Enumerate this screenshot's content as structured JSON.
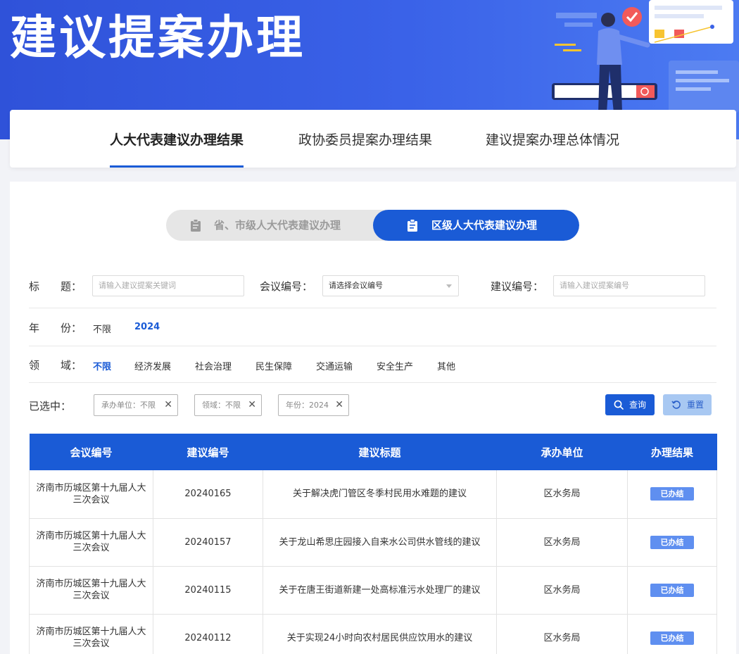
{
  "banner": {
    "title": "建议提案办理"
  },
  "top_tabs": [
    {
      "label": "人大代表建议办理结果",
      "active": true
    },
    {
      "label": "政协委员提案办理结果",
      "active": false
    },
    {
      "label": "建议提案办理总体情况",
      "active": false
    }
  ],
  "segment": {
    "left_label": "省、市级人大代表建议办理",
    "right_label": "区级人大代表建议办理",
    "icon": "clipboard-icon"
  },
  "filters": {
    "title_label": "标　　题：",
    "title_placeholder": "请输入建议提案关键词",
    "meeting_label": "会议编号：",
    "meeting_value": "请选择会议编号",
    "number_label": "建议编号：",
    "number_placeholder": "请输入建议提案编号",
    "year_label": "年　　份：",
    "year_options": [
      "不限",
      "2024"
    ],
    "field_label": "领　　域：",
    "field_options": [
      "不限",
      "经济发展",
      "社会治理",
      "民生保障",
      "交通运输",
      "安全生产",
      "其他"
    ],
    "selected_label": "已选中：",
    "chips": [
      "承办单位：不限",
      "领域：不限",
      "年份：2024"
    ],
    "query_label": "查询",
    "reset_label": "重置"
  },
  "table": {
    "headers": [
      "会议编号",
      "建议编号",
      "建议标题",
      "承办单位",
      "办理结果"
    ],
    "rows": [
      {
        "meeting": "济南市历城区第十九届人大三次会议",
        "number": "20240165",
        "title": "关于解决虎门管区冬季村民用水难题的建议",
        "unit": "区水务局",
        "result": "已办结"
      },
      {
        "meeting": "济南市历城区第十九届人大三次会议",
        "number": "20240157",
        "title": "关于龙山希思庄园接入自来水公司供水管线的建议",
        "unit": "区水务局",
        "result": "已办结"
      },
      {
        "meeting": "济南市历城区第十九届人大三次会议",
        "number": "20240115",
        "title": "关于在唐王街道新建一处高标准污水处理厂的建议",
        "unit": "区水务局",
        "result": "已办结"
      },
      {
        "meeting": "济南市历城区第十九届人大三次会议",
        "number": "20240112",
        "title": "关于实现24小时向农村居民供应饮用水的建议",
        "unit": "区水务局",
        "result": "已办结"
      }
    ]
  },
  "colors": {
    "primary": "#1a5bd6",
    "badge": "#5f8ff0",
    "banner": "#3a62e8"
  }
}
